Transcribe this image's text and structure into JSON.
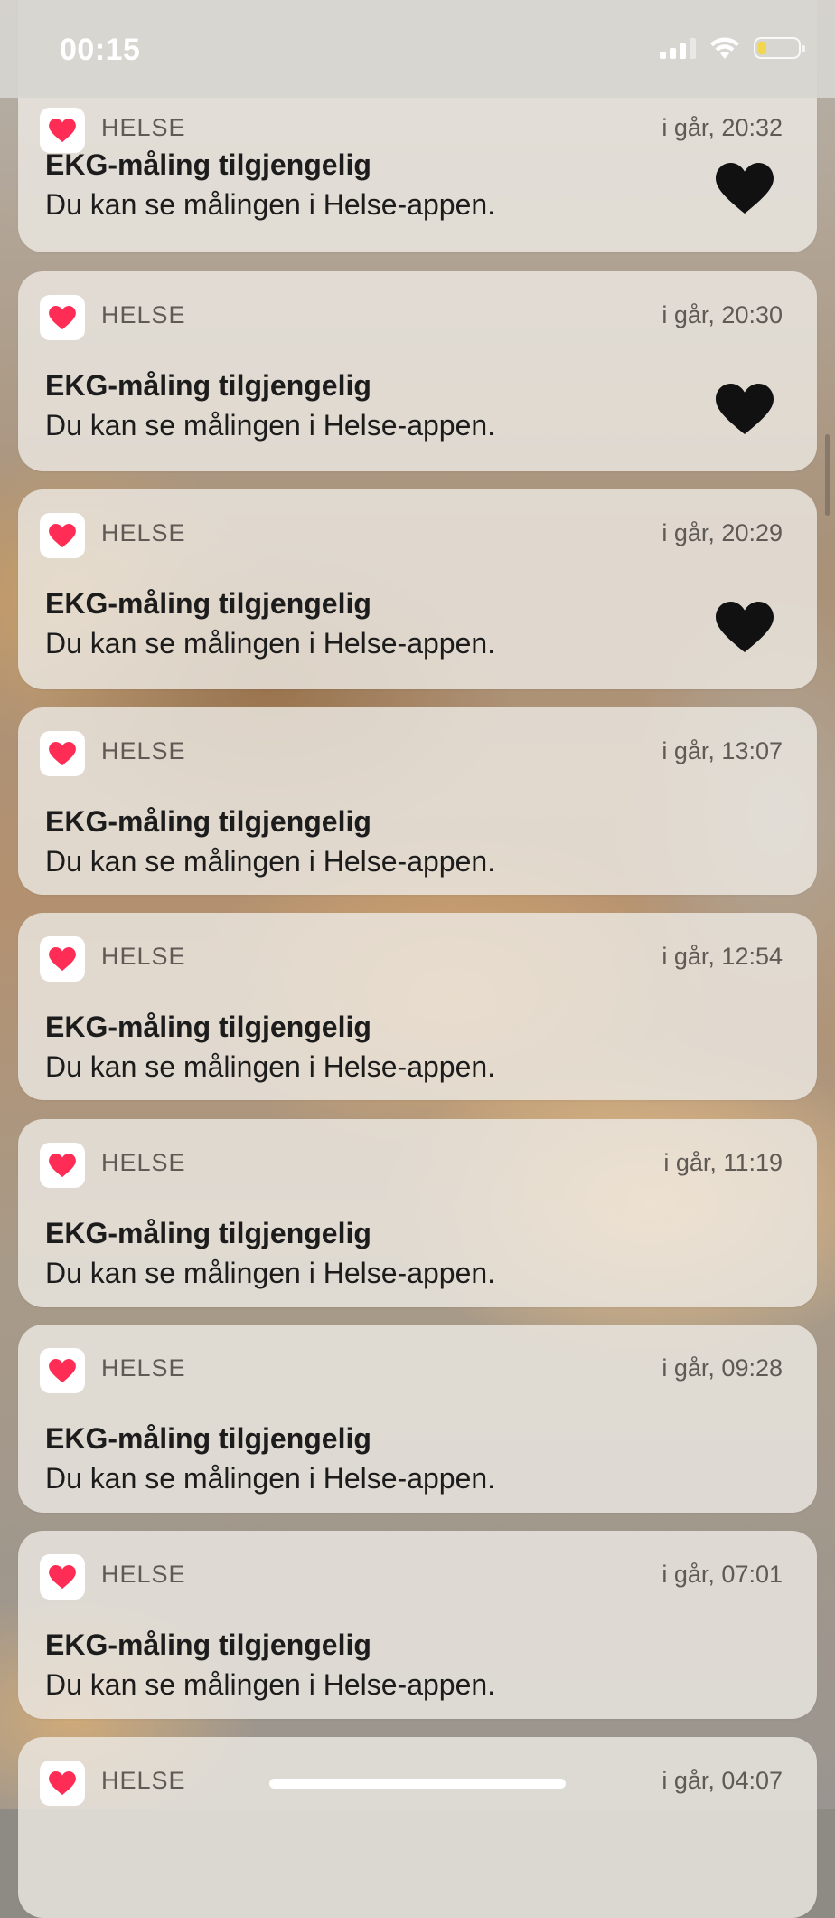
{
  "status_bar": {
    "time": "00:15",
    "battery_color": "#f2d64b"
  },
  "notifications": [
    {
      "app": "HELSE",
      "time": "i går, 20:32",
      "title": "EKG-måling tilgjengelig",
      "body": "Du kan se målingen i Helse-appen.",
      "has_heart": true
    },
    {
      "app": "HELSE",
      "time": "i går, 20:30",
      "title": "EKG-måling tilgjengelig",
      "body": "Du kan se målingen i Helse-appen.",
      "has_heart": true
    },
    {
      "app": "HELSE",
      "time": "i går, 20:29",
      "title": "EKG-måling tilgjengelig",
      "body": "Du kan se målingen i Helse-appen.",
      "has_heart": true
    },
    {
      "app": "HELSE",
      "time": "i går, 13:07",
      "title": "EKG-måling tilgjengelig",
      "body": "Du kan se målingen i Helse-appen.",
      "has_heart": false
    },
    {
      "app": "HELSE",
      "time": "i går, 12:54",
      "title": "EKG-måling tilgjengelig",
      "body": "Du kan se målingen i Helse-appen.",
      "has_heart": false
    },
    {
      "app": "HELSE",
      "time": "i går, 11:19",
      "title": "EKG-måling tilgjengelig",
      "body": "Du kan se målingen i Helse-appen.",
      "has_heart": false
    },
    {
      "app": "HELSE",
      "time": "i går, 09:28",
      "title": "EKG-måling tilgjengelig",
      "body": "Du kan se målingen i Helse-appen.",
      "has_heart": false
    },
    {
      "app": "HELSE",
      "time": "i går, 07:01",
      "title": "EKG-måling tilgjengelig",
      "body": "Du kan se målingen i Helse-appen.",
      "has_heart": false
    },
    {
      "app": "HELSE",
      "time": "i går, 04:07",
      "title": "",
      "body": "",
      "has_heart": false
    }
  ],
  "icons": {
    "app_icon": "health-heart-icon",
    "thumbnail": "heart-icon",
    "status": [
      "cellular-signal-icon",
      "wifi-icon",
      "battery-icon"
    ]
  },
  "colors": {
    "health_heart": "#ff2d55",
    "thumbnail_heart": "#111111"
  }
}
